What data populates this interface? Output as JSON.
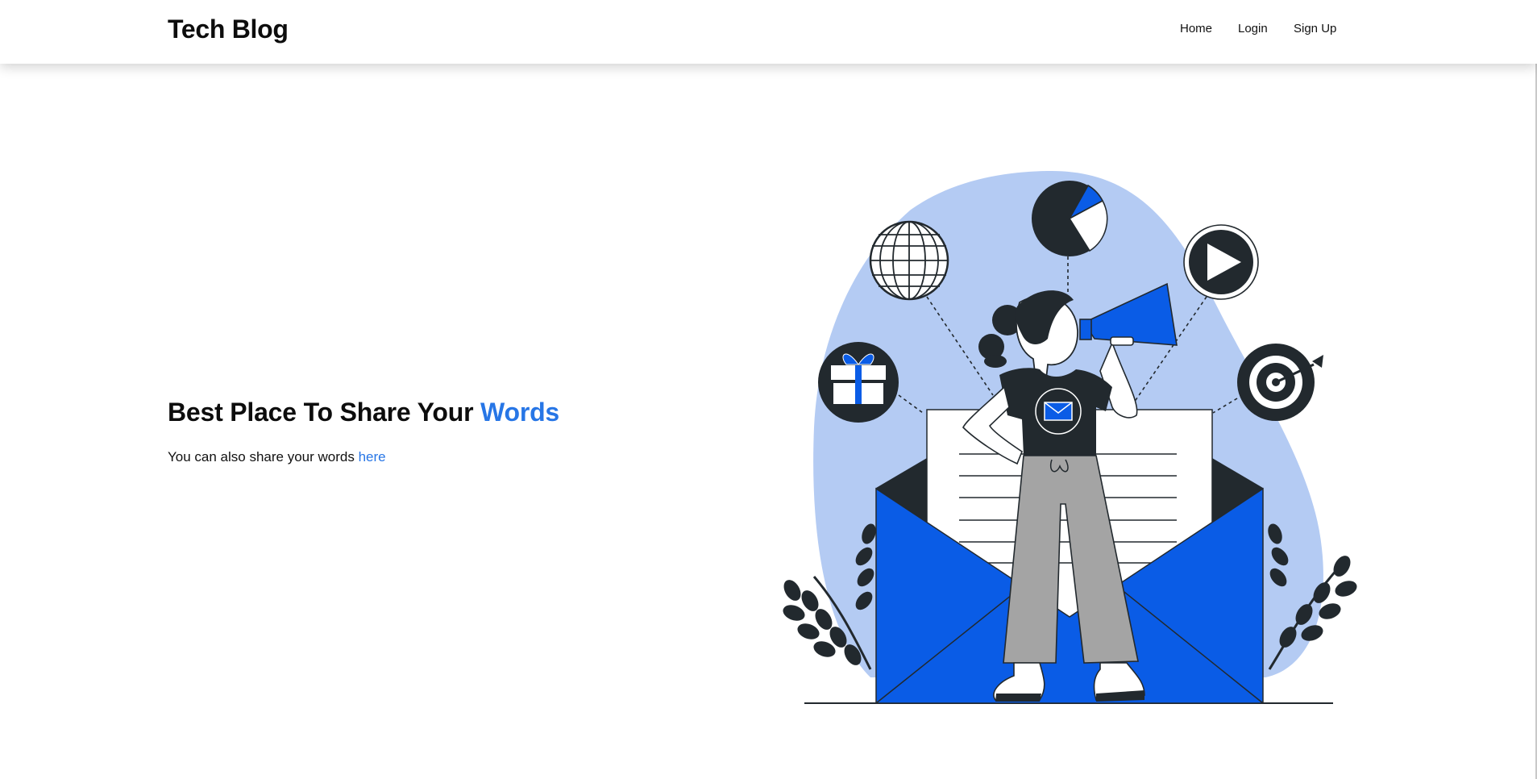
{
  "navbar": {
    "brand": "Tech Blog",
    "links": [
      {
        "label": "Home"
      },
      {
        "label": "Login"
      },
      {
        "label": "Sign Up"
      }
    ]
  },
  "hero": {
    "title_prefix": "Best Place To Share Your",
    "title_accent": "Words",
    "subtitle_prefix": "You can also share your words",
    "subtitle_link": "here"
  },
  "colors": {
    "accent": "#2776e6",
    "illustration_blue": "#0a5ce6",
    "blob": "#b4cbf3",
    "dark": "#22292e"
  },
  "illustration": {
    "subject": "woman with megaphone in front of open envelope",
    "icons": [
      "globe-icon",
      "pie-chart-icon",
      "play-icon",
      "gift-icon",
      "target-icon",
      "mail-icon"
    ]
  }
}
